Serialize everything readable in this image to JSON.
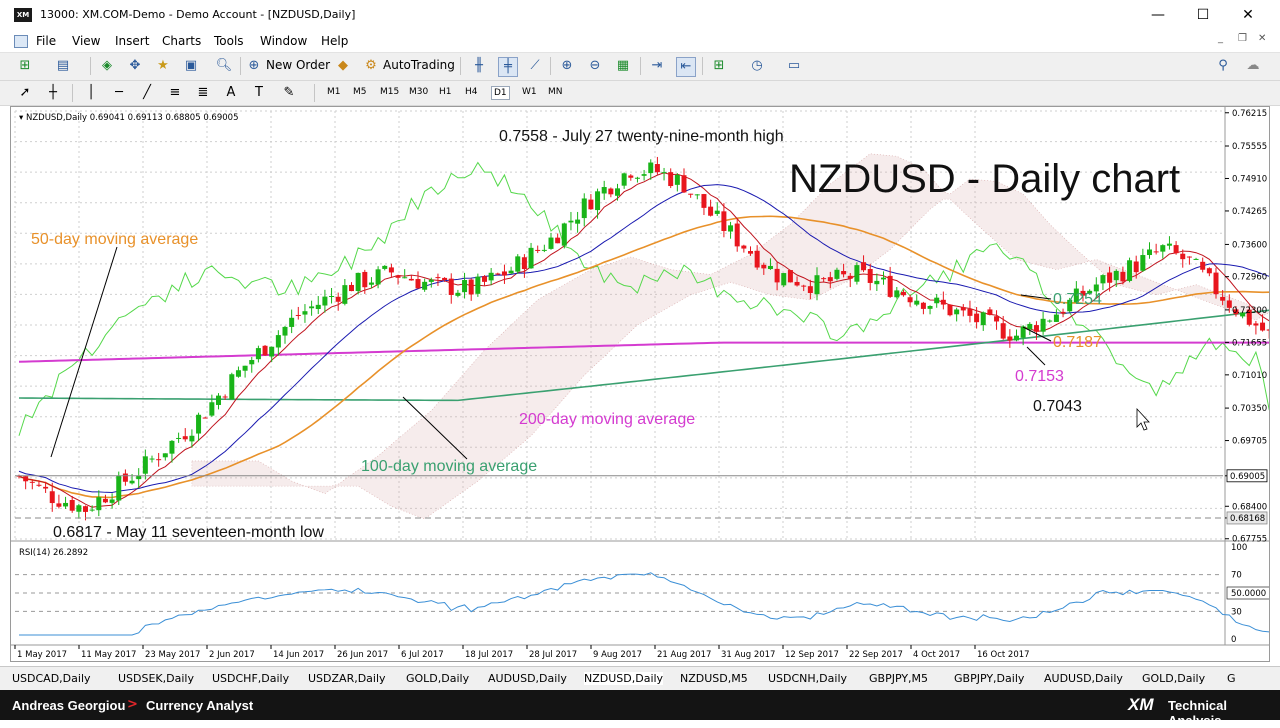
{
  "window": {
    "title": "13000: XM.COM-Demo - Demo Account - [NZDUSD,Daily]",
    "icon_text": "XM",
    "minimize": "—",
    "maximize": "☐",
    "close": "✕"
  },
  "menu": [
    "File",
    "View",
    "Insert",
    "Charts",
    "Tools",
    "Window",
    "Help"
  ],
  "toolbar": {
    "new_order": "New Order",
    "autotrading": "AutoTrading"
  },
  "timeframes": [
    "M1",
    "M5",
    "M15",
    "M30",
    "H1",
    "H4",
    "D1",
    "W1",
    "MN"
  ],
  "active_timeframe": "D1",
  "chart": {
    "symbol_info": "NZDUSD,Daily  0.69041 0.69113 0.68805 0.69005",
    "big_title": "NZDUSD - Daily chart",
    "high_annotation": "0.7558 - July 27 twenty-nine-month high",
    "low_annotation": "0.6817 - May 11 seventeen-month low",
    "ma_labels": {
      "ma50": "50-day moving average",
      "ma100": "100-day moving average",
      "ma200": "200-day moving average"
    },
    "level_labels": {
      "v7254": "0.7254",
      "v7187": "0.7187",
      "v7153": "0.7153",
      "v7043": "0.7043"
    },
    "price_ticks": [
      "0.76215",
      "0.75555",
      "0.74910",
      "0.74265",
      "0.73600",
      "0.72960",
      "0.72300",
      "0.71655",
      "0.71010",
      "0.70350",
      "0.69705",
      "0.69005",
      "0.68400",
      "0.68168",
      "0.67755"
    ],
    "current_price": "0.69005",
    "low_price_tag": "0.68168",
    "date_ticks": [
      "1 May 2017",
      "11 May 2017",
      "23 May 2017",
      "2 Jun 2017",
      "14 Jun 2017",
      "26 Jun 2017",
      "6 Jul 2017",
      "18 Jul 2017",
      "28 Jul 2017",
      "9 Aug 2017",
      "21 Aug 2017",
      "31 Aug 2017",
      "12 Sep 2017",
      "22 Sep 2017",
      "4 Oct 2017",
      "16 Oct 2017"
    ],
    "colors": {
      "ma50": "#e8912a",
      "ma100": "#3aa070",
      "ma200": "#d43bd0",
      "tenkan": "#c0141e",
      "kijun": "#1a1ab0",
      "chikou": "#55d84b",
      "bull": "#19b419",
      "bear": "#e8161e",
      "cloud": "#d6a8a8",
      "rsi": "#3b8fd6"
    },
    "rsi": {
      "label": "RSI(14) 26.2892",
      "ticks": [
        "100",
        "70",
        "50.0000",
        "30",
        "0"
      ]
    }
  },
  "chart_data": {
    "type": "candlestick",
    "title": "NZDUSD - Daily chart",
    "ylim": [
      0.6775,
      0.7625
    ],
    "x": [
      "1 May 2017",
      "11 May 2017",
      "23 May 2017",
      "2 Jun 2017",
      "14 Jun 2017",
      "26 Jun 2017",
      "6 Jul 2017",
      "18 Jul 2017",
      "28 Jul 2017",
      "9 Aug 2017",
      "21 Aug 2017",
      "31 Aug 2017",
      "12 Sep 2017",
      "22 Sep 2017",
      "4 Oct 2017",
      "16 Oct 2017"
    ],
    "close_approx": [
      0.6885,
      0.684,
      0.6975,
      0.7125,
      0.7265,
      0.731,
      0.73,
      0.74,
      0.7475,
      0.7315,
      0.7285,
      0.7215,
      0.731,
      0.7245,
      0.711,
      0.716,
      0.69
    ],
    "annotations": [
      {
        "date": "27 Jul 2017",
        "value": 0.7558,
        "text": "0.7558 - July 27 twenty-nine-month high"
      },
      {
        "date": "11 May 2017",
        "value": 0.6817,
        "text": "0.6817 - May 11 seventeen-month low"
      }
    ],
    "series_end_values": {
      "100-day moving average": 0.7254,
      "50-day moving average": 0.7187,
      "200-day moving average": 0.7153,
      "Kijun": 0.7043
    },
    "rsi_last": 26.2892
  },
  "bottom_tabs": [
    "USDCAD,Daily",
    "USDSEK,Daily",
    "USDCHF,Daily",
    "USDZAR,Daily",
    "GOLD,Daily",
    "AUDUSD,Daily",
    "NZDUSD,Daily",
    "NZDUSD,M5",
    "USDCNH,Daily",
    "GBPJPY,M5",
    "GBPJPY,Daily",
    "AUDUSD,Daily",
    "GOLD,Daily",
    "G"
  ],
  "active_tab": "NZDUSD,Daily",
  "footer": {
    "author": "Andreas Georgiou",
    "arrow": ">",
    "role": "Currency Analyst",
    "brand": "XM",
    "brand_sub": "Technical Analysis"
  }
}
